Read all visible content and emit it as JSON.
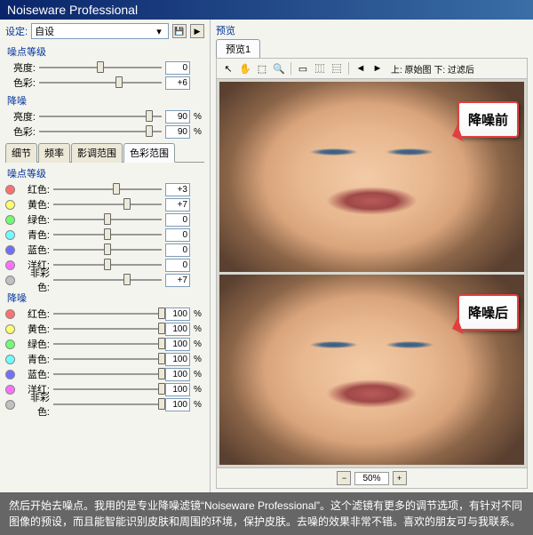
{
  "title": "Noiseware Professional",
  "settings": {
    "label": "设定:",
    "value": "自设"
  },
  "noise_level": {
    "header": "噪点等级",
    "rows": [
      {
        "label": "亮度:",
        "val": "0",
        "thumb": 50
      },
      {
        "label": "色彩:",
        "val": "+6",
        "thumb": 65
      }
    ]
  },
  "noise_reduce": {
    "header": "降噪",
    "rows": [
      {
        "label": "亮度:",
        "val": "90",
        "unit": "%",
        "thumb": 90
      },
      {
        "label": "色彩:",
        "val": "90",
        "unit": "%",
        "thumb": 90
      }
    ]
  },
  "tabs": [
    "细节",
    "频率",
    "影调范围",
    "色彩范围"
  ],
  "active_tab": 3,
  "color_noise_level": {
    "header": "噪点等级",
    "rows": [
      {
        "label": "红色:",
        "color": "#ff7070",
        "val": "+3",
        "thumb": 58
      },
      {
        "label": "黄色:",
        "color": "#ffff70",
        "val": "+7",
        "thumb": 68
      },
      {
        "label": "绿色:",
        "color": "#70ff70",
        "val": "0",
        "thumb": 50
      },
      {
        "label": "青色:",
        "color": "#70ffff",
        "val": "0",
        "thumb": 50
      },
      {
        "label": "蓝色:",
        "color": "#7070ff",
        "val": "0",
        "thumb": 50
      },
      {
        "label": "洋红:",
        "color": "#ff70ff",
        "val": "0",
        "thumb": 50
      },
      {
        "label": "非彩色:",
        "color": "#c0c0c0",
        "val": "+7",
        "thumb": 68
      }
    ]
  },
  "color_noise_reduce": {
    "header": "降噪",
    "rows": [
      {
        "label": "红色:",
        "color": "#ff7070",
        "val": "100",
        "unit": "%",
        "thumb": 100
      },
      {
        "label": "黄色:",
        "color": "#ffff70",
        "val": "100",
        "unit": "%",
        "thumb": 100
      },
      {
        "label": "绿色:",
        "color": "#70ff70",
        "val": "100",
        "unit": "%",
        "thumb": 100
      },
      {
        "label": "青色:",
        "color": "#70ffff",
        "val": "100",
        "unit": "%",
        "thumb": 100
      },
      {
        "label": "蓝色:",
        "color": "#7070ff",
        "val": "100",
        "unit": "%",
        "thumb": 100
      },
      {
        "label": "洋红:",
        "color": "#ff70ff",
        "val": "100",
        "unit": "%",
        "thumb": 100
      },
      {
        "label": "非彩色:",
        "color": "#c0c0c0",
        "val": "100",
        "unit": "%",
        "thumb": 100
      }
    ]
  },
  "preview": {
    "header": "预览",
    "tab": "预览1",
    "toolbar_text": "上: 原始图   下: 过滤后",
    "before_label": "降噪前",
    "after_label": "降噪后",
    "zoom": "50%"
  },
  "caption": "然后开始去噪点。我用的是专业降噪滤镜“Noiseware Professional”。这个滤镜有更多的调节选项，有针对不同图像的预设，而且能智能识别皮肤和周围的环境，保护皮肤。去噪的效果非常不错。喜欢的朋友可与我联系。"
}
